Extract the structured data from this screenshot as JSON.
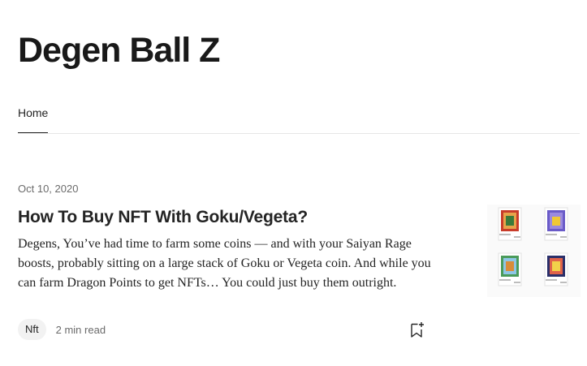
{
  "publication": {
    "title": "Degen Ball Z"
  },
  "nav": {
    "tabs": [
      {
        "label": "Home",
        "active": true
      }
    ]
  },
  "article": {
    "date": "Oct 10, 2020",
    "title": "How To Buy NFT With Goku/Vegeta?",
    "excerpt": "Degens, You’ve had time to farm some coins — and with your Saiyan Rage boosts, probably sitting on a large stack of Goku or Vegeta coin. And while you can farm Dragon Points to get NFTs… You could just buy them outright.",
    "tag": "Nft",
    "read_time": "2 min read",
    "thumbnail_icon": "nft-cards-thumbnail"
  },
  "colors": {
    "text": "#242424",
    "muted": "#6b6b6b",
    "tag_bg": "#f2f2f2",
    "divider": "#e6e6e6"
  }
}
